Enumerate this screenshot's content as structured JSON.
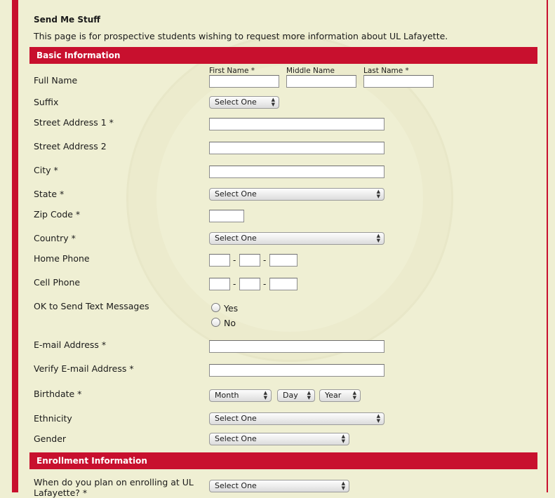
{
  "page": {
    "title": "Send Me Stuff",
    "intro": "This page is for prospective students wishing to request more information about UL Lafayette."
  },
  "sections": {
    "basic": "Basic Information",
    "enrollment": "Enrollment Information"
  },
  "labels": {
    "full_name": "Full Name",
    "first_name": "First Name *",
    "middle_name": "Middle Name",
    "last_name": "Last Name *",
    "suffix": "Suffix",
    "street1": "Street Address 1 *",
    "street2": "Street Address 2",
    "city": "City *",
    "state": "State *",
    "zip": "Zip Code *",
    "country": "Country *",
    "home_phone": "Home Phone",
    "cell_phone": "Cell Phone",
    "ok_text": "OK to Send Text Messages",
    "yes": "Yes",
    "no": "No",
    "email": "E-mail Address *",
    "verify_email": "Verify E-mail Address *",
    "birthdate": "Birthdate *",
    "ethnicity": "Ethnicity",
    "gender": "Gender",
    "enroll_when_1": "When do you plan on enrolling at UL",
    "enroll_when_2": "Lafayette? *"
  },
  "selects": {
    "suffix": "Select One",
    "state": "Select One",
    "country": "Select One",
    "month": "Month",
    "day": "Day",
    "year": "Year",
    "ethnicity": "Select One",
    "gender": "Select One",
    "enroll_when": "Select One"
  },
  "dash": "-",
  "colors": {
    "accent": "#c8102e",
    "background": "#efefd3"
  }
}
